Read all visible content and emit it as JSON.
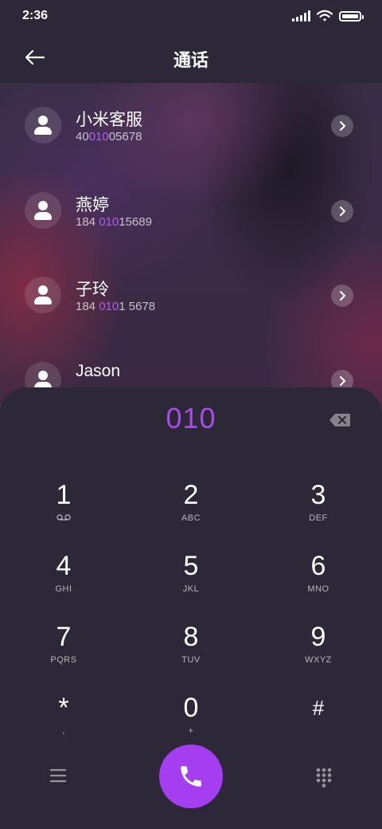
{
  "status_bar": {
    "time": "2:36"
  },
  "header": {
    "title": "通话"
  },
  "contacts": [
    {
      "name": "小米客服",
      "number_pre": "40",
      "number_hl": "010",
      "number_post": "05678"
    },
    {
      "name": "燕婷",
      "number_pre": "184 ",
      "number_hl": "010",
      "number_post": "15689"
    },
    {
      "name": "子玲",
      "number_pre": "184 ",
      "number_hl": "010",
      "number_post": "1 5678"
    },
    {
      "name": "Jason",
      "number_pre": "",
      "number_hl": "",
      "number_post": ""
    }
  ],
  "dialer": {
    "input": "010",
    "keys": [
      {
        "digit": "1",
        "sub": ""
      },
      {
        "digit": "2",
        "sub": "ABC"
      },
      {
        "digit": "3",
        "sub": "DEF"
      },
      {
        "digit": "4",
        "sub": "GHI"
      },
      {
        "digit": "5",
        "sub": "JKL"
      },
      {
        "digit": "6",
        "sub": "MNO"
      },
      {
        "digit": "7",
        "sub": "PQRS"
      },
      {
        "digit": "8",
        "sub": "TUV"
      },
      {
        "digit": "9",
        "sub": "WXYZ"
      },
      {
        "digit": "*",
        "sub": ","
      },
      {
        "digit": "0",
        "sub": "+"
      },
      {
        "digit": "#",
        "sub": ""
      }
    ]
  },
  "colors": {
    "accent": "#a53ef0",
    "highlight": "#b15cf0",
    "panel": "#2c2838"
  },
  "icons": {
    "back": "arrow-left-icon",
    "voicemail": "voicemail-icon",
    "backspace": "backspace-icon",
    "menu": "menu-icon",
    "call": "phone-icon",
    "keypad": "keypad-icon"
  }
}
